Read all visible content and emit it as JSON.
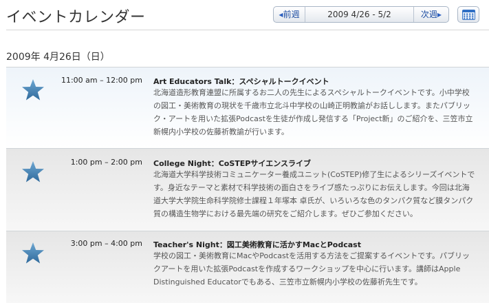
{
  "header": {
    "title": "イベントカレンダー",
    "prev_label": "前週",
    "date_range": "2009 4/26 - 5/2",
    "next_label": "次週",
    "calendar_icon": "calendar-icon"
  },
  "day": {
    "heading": "2009年 4月26日（日）"
  },
  "colors": {
    "star": "#3f7fb0",
    "link": "#1a4ba0"
  },
  "events": [
    {
      "icon": "star-icon",
      "time": "11:00 am – 12:00 pm",
      "title": "Art Educators Talk：スペシャルトークイベント",
      "lines": [
        "北海道造形教育連盟に所属するお二人の先生によるスペシャルトークイベントです。小中学校",
        "の図工・美術教育の現状を千歳市立北斗中学校の山崎正明教諭がお話しします。またパブリッ",
        "ク・アートを用いた拡張Podcastを生徒が作成し発信する「Project新」のご紹介を、三笠市立",
        "新幌内小学校の佐藤祈教諭が行います。"
      ]
    },
    {
      "icon": "star-icon",
      "time": "1:00 pm – 2:00 pm",
      "title": "College Night：CoSTEPサイエンスライブ",
      "lines": [
        "北海道大学科学技術コミュニケーター養成ユニット(CoSTEP)修了生によるシリーズイベントで",
        "す。身近なテーマと素材で科学技術の面白さをライブ感たっぷりにお伝えします。今回は北海",
        "道大学大学院生命科学院修士課程１年塚本 卓氏が、いろいろな色のタンパク質など膜タンパク",
        "質の構造生物学における最先端の研究をご紹介します。ぜひご参加ください。"
      ]
    },
    {
      "icon": "star-icon",
      "time": "3:00 pm – 4:00 pm",
      "title": "Teacher's Night：図工美術教育に活かすMacとPodcast",
      "lines": [
        "学校の図工・美術教育にMacやPodcastを活用する方法をご提案するイベントです。パブリッ",
        "クアートを用いた拡張Podcastを作成するワークショップを中心に行います。講師はApple",
        "Distinguished Educatorでもある、三笠市立新幌内小学校の佐藤祈先生です。"
      ]
    }
  ]
}
